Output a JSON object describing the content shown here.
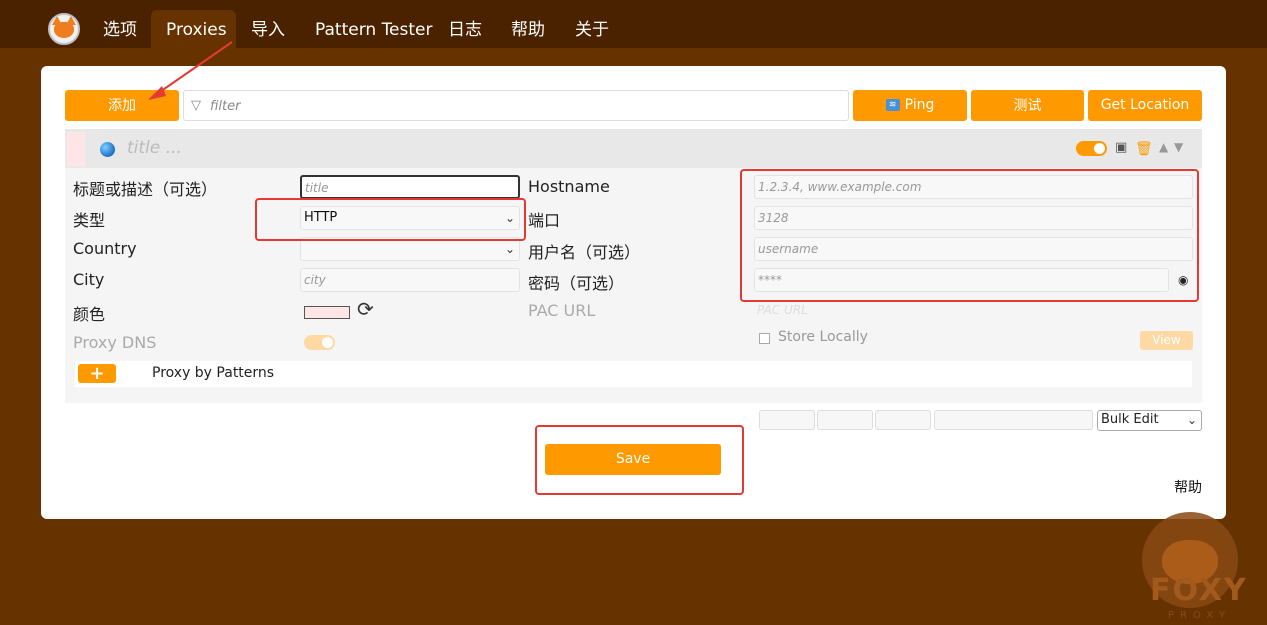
{
  "nav": {
    "tabs": [
      {
        "label": "选项"
      },
      {
        "label": "Proxies",
        "active": true
      },
      {
        "label": "导入"
      },
      {
        "label": "Pattern Tester"
      },
      {
        "label": "日志"
      },
      {
        "label": "帮助"
      },
      {
        "label": "关于"
      }
    ]
  },
  "toolbar": {
    "add_label": "添加",
    "filter_placeholder": "filter",
    "ping_label": "Ping",
    "test_label": "测试",
    "location_label": "Get Location"
  },
  "proxy": {
    "title_placeholder": "title ...",
    "fields": {
      "title_label": "标题或描述（可选）",
      "title_placeholder": "title",
      "type_label": "类型",
      "type_value": "HTTP",
      "country_label": "Country",
      "country_value": "",
      "city_label": "City",
      "city_placeholder": "city",
      "color_label": "颜色",
      "color_value": "#ffe5e5",
      "proxy_dns_label": "Proxy DNS",
      "hostname_label": "Hostname",
      "hostname_placeholder": "1.2.3.4, www.example.com",
      "port_label": "端口",
      "port_placeholder": "3128",
      "username_label": "用户名（可选）",
      "username_placeholder": "username",
      "password_label": "密码（可选）",
      "password_placeholder": "****",
      "pac_label": "PAC URL",
      "pac_placeholder": "PAC URL",
      "store_locally_label": "Store Locally",
      "view_label": "View"
    },
    "patterns_label": "Proxy by Patterns"
  },
  "bulk_edit_label": "Bulk Edit",
  "save_label": "Save",
  "help_label": "帮助",
  "watermark": {
    "text": "FOXY",
    "sub": "PROXY"
  },
  "colors": {
    "accent": "#ff9900",
    "background": "#663300",
    "annotation": "#e53935"
  }
}
